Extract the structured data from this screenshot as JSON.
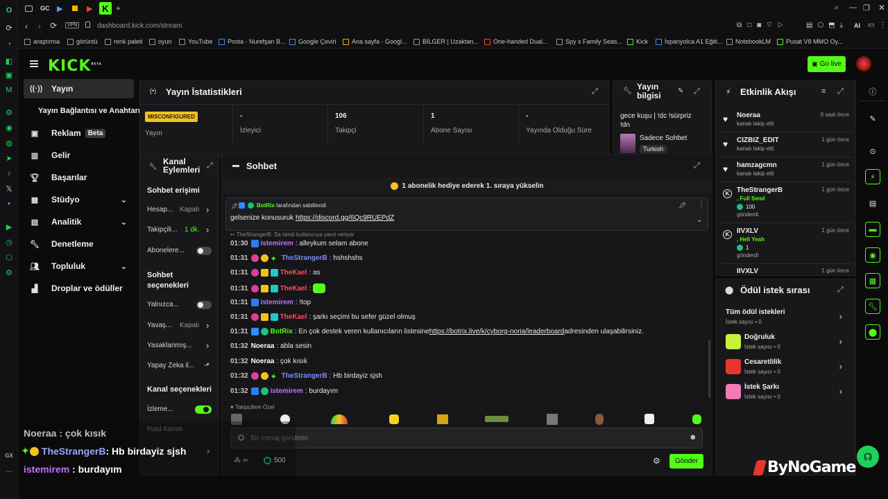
{
  "browser": {
    "url": "dashboard.kick.com/stream",
    "url_host": "dashboard.kick.com",
    "url_path": "/stream",
    "vpn": "VPN",
    "tab_gc": "GC",
    "ai_label": "AI",
    "gx_label": "GX",
    "bookmarks": [
      "araştırma",
      "görüntü",
      "renk paleti",
      "oyun",
      "YouTube",
      "Posta - Nurefşan B...",
      "Google Çeviri",
      "Ana sayfa - Googl...",
      "BİLGER | Uzaktan...",
      "One-handed Dual...",
      "Spy x Family Seas...",
      "Kick",
      "İspanyolca A1 Eğiti...",
      "NotebookLM",
      "Pusat V8 MMO Oy..."
    ]
  },
  "header": {
    "logo": "KICK",
    "beta": "BETA",
    "go_live": "Go live"
  },
  "nav": {
    "items": [
      {
        "label": "Yayın",
        "icon": "broadcast-icon"
      },
      {
        "label": "Yayın Bağlantısı ve Anahtarı"
      },
      {
        "label": "Reklam",
        "icon": "ad-icon",
        "badge": "Beta"
      },
      {
        "label": "Gelir",
        "icon": "chart-icon"
      },
      {
        "label": "Başarılar",
        "icon": "trophy-icon"
      },
      {
        "label": "Stüdyo",
        "icon": "studio-icon"
      },
      {
        "label": "Analitik",
        "icon": "analytics-icon"
      },
      {
        "label": "Denetleme",
        "icon": "wrench-icon"
      },
      {
        "label": "Topluluk",
        "icon": "community-icon"
      },
      {
        "label": "Droplar ve ödüller",
        "icon": "gift-icon"
      }
    ]
  },
  "stats": {
    "title": "Yayın İstatistikleri",
    "status_badge": "MISCONFIGURED",
    "status_label": "Yayın",
    "cells": [
      {
        "value": "-",
        "label": "İzleyici"
      },
      {
        "value": "106",
        "label": "Takipçi"
      },
      {
        "value": "1",
        "label": "Abone Sayısı"
      },
      {
        "value": "-",
        "label": "Yayında Olduğu Süre"
      }
    ]
  },
  "stream_info": {
    "title_line1": "Yayın",
    "title_line2": "bilgisi",
    "stream_title_1": "gece kuşu | !dc !sürpriz",
    "stream_title_2": "!dn",
    "category": "Sadece Sohbet",
    "language": "Turkish"
  },
  "activity": {
    "title": "Etkinlik Akışı",
    "items": [
      {
        "name": "Noeraa",
        "sub": "kanalı takip etti",
        "time": "9 saat önce",
        "icon": "heart-icon"
      },
      {
        "name": "CIZBIZ_EDIT",
        "sub": "kanalı takip etti",
        "time": "1 gün önce",
        "icon": "heart-icon"
      },
      {
        "name": "hamzagcmn",
        "sub": "kanalı takip etti",
        "time": "1 gün önce",
        "icon": "heart-icon"
      },
      {
        "name": "TheStrangerB",
        "sub2": ", Full Send",
        "amount": "100",
        "sub": "gönderdi",
        "time": "1 gün önce",
        "icon": "kick-icon"
      },
      {
        "name": "IIVXLV",
        "sub2": ", Hell Yeah",
        "amount": "1",
        "sub": "gönderdi",
        "time": "1 gün önce",
        "icon": "kick-icon"
      },
      {
        "name": "IIVXLV",
        "time": "1 gün önce"
      }
    ]
  },
  "rewards": {
    "title": "Ödül istek sırası",
    "items": [
      {
        "name": "Tüm ödül istekleri",
        "sub": "İstek sayısı • 0",
        "color": ""
      },
      {
        "name": "Doğruluk",
        "sub": "İstek sayısı • 0",
        "color": "#c6f23a"
      },
      {
        "name": "Cesaretlilik",
        "sub": "İstek sayısı • 0",
        "color": "#e8362f"
      },
      {
        "name": "İstek Şarkı",
        "sub": "İstek sayısı • 0",
        "color": "#f27ab6"
      }
    ]
  },
  "channel_actions": {
    "title_1": "Kanal",
    "title_2": "Eylemleri",
    "chat_access": "Sohbet erişimi",
    "account_label": "Hesap...",
    "account_value": "Kapalı",
    "followers_label": "Takipçili...",
    "followers_value": "1 dk.",
    "subscribers_label": "Abonelere...",
    "chat_opts_1": "Sohbet",
    "chat_opts_2": "seçenekleri",
    "only_label": "Yalnızca...",
    "slow_label": "Yavaş...",
    "slow_value": "Kapalı",
    "banned_label": "Yasaklanmış...",
    "ai_label": "Yapay Zeka il...",
    "channel_opts": "Kanal seçenekleri",
    "watch_label": "İzleme...",
    "raid_label": "Raid Kanalı"
  },
  "chat": {
    "title": "Sohbet",
    "gift_banner": "1 abonelik hediye ederek 1. sıraya yükselin",
    "pinned_by": "BotRix",
    "pinned_suffix": "tarafından sabitlendi",
    "pinned_text": "gelsenize konusuruk",
    "pinned_link": "https://discord.gg/6Qc9RUEPdZ",
    "reply_note": "TheStrangerB: Sa isimli kullanıcıya yanıt veriyor",
    "messages": [
      {
        "time": "01:30",
        "user": "istemirem",
        "color": "#c271ff",
        "text": ": alleykum selam abone"
      },
      {
        "time": "01:31",
        "user": "TheStrangerB",
        "color": "#7b8bff",
        "text": ": hshshshs"
      },
      {
        "time": "01:31",
        "user": "TheKael",
        "color": "#ff4b5c",
        "text": ": as"
      },
      {
        "time": "01:31",
        "user": "TheKael",
        "color": "#ff4b5c",
        "text": ":"
      },
      {
        "time": "01:31",
        "user": "istemirem",
        "color": "#c271ff",
        "text": ": !top"
      },
      {
        "time": "01:31",
        "user": "TheKael",
        "color": "#ff4b5c",
        "text": ": şarkı seçimi bu sefer güzel olmuş"
      },
      {
        "time": "01:31",
        "user": "BotRix",
        "color": "#53fc18",
        "text": ": En çok destek veren kullanıcıların listesine ",
        "link": "https://botrix.live/k/cyborg-noria/leaderboard",
        "after": " adresinden ulaşabilirsiniz."
      },
      {
        "time": "01:32",
        "user": "Noeraa",
        "color": "#ffffff",
        "text": ": abla sesin"
      },
      {
        "time": "01:32",
        "user": "Noeraa",
        "color": "#ffffff",
        "text": ": çok kısık"
      },
      {
        "time": "01:32",
        "user": "TheStrangerB",
        "color": "#7b8bff",
        "text": ": Hb birdayiz sjsh"
      },
      {
        "time": "01:32",
        "user": "istemirem",
        "color": "#c271ff",
        "text": ": burdayım"
      }
    ],
    "followers_only": "Takipçilere Özel",
    "input_placeholder": "Bir mesaj gönderin",
    "points": "500",
    "infinity": "∞",
    "send": "Gönder"
  },
  "overlay": {
    "lines": [
      {
        "user": "Noeraa",
        "text": " : çok kısık",
        "color": "#bdbdbd"
      },
      {
        "user": "TheStrangerB",
        "text": " : Hb birdayiz sjsh",
        "color": "#9aa6ff"
      },
      {
        "user": "istemirem",
        "text": " : burdayım",
        "color": "#c271ff"
      }
    ],
    "watermark": "ByNoGame"
  }
}
